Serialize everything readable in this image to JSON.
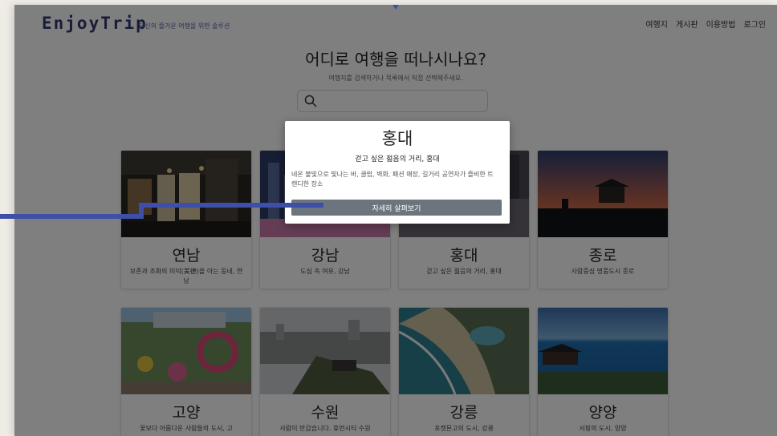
{
  "nav": {
    "logo": "EnjoyTrip",
    "tagline": "당신의 즐거운 여행을 위한 솔루션",
    "menu": [
      "여행지",
      "게시판",
      "이용방법",
      "로그인"
    ]
  },
  "hero": {
    "title": "어디로 여행을 떠나시나요?",
    "subtitle": "여행지를 검색하거나 목록에서 직접 선택해주세요.",
    "search_placeholder": ""
  },
  "cards": [
    {
      "name": "연남",
      "desc": "보존과 조화의 미덕(美德)을 아는 동네, 연남",
      "image": "night-alley-photo"
    },
    {
      "name": "강남",
      "desc": "도심 속 여유, 강남",
      "image": "city-lights-photo"
    },
    {
      "name": "홍대",
      "desc": "걷고 싶은 젊음의 거리, 홍대",
      "image": "street-photo"
    },
    {
      "name": "종로",
      "desc": "사람중심 명품도시 종로",
      "image": "palace-sunset-photo"
    },
    {
      "name": "고양",
      "desc": "꽃보다 아름다운 사람들의 도시, 고",
      "image": "flower-festival-photo"
    },
    {
      "name": "수원",
      "desc": "사람이 반갑습니다. 휴먼시티 수원",
      "image": "fortress-photo"
    },
    {
      "name": "강릉",
      "desc": "포켓몬고의 도시, 강릉",
      "image": "coastline-photo"
    },
    {
      "name": "양양",
      "desc": "서핑의 도시, 양양",
      "image": "sea-pavilion-photo"
    }
  ],
  "modal": {
    "title": "홍대",
    "subtitle": "걷고 싶은 젊음의 거리, 홍대",
    "description": "네온 불빛으로 빛나는 바, 클럽, 벽화, 패션 매장, 길거리 공연자가 즐비한 트렌디한 장소",
    "button": "자세히 살펴보기"
  },
  "colors": {
    "accent": "#3d4fa8",
    "button": "#6c757d",
    "overlay": "rgba(0,0,0,0.5)"
  }
}
